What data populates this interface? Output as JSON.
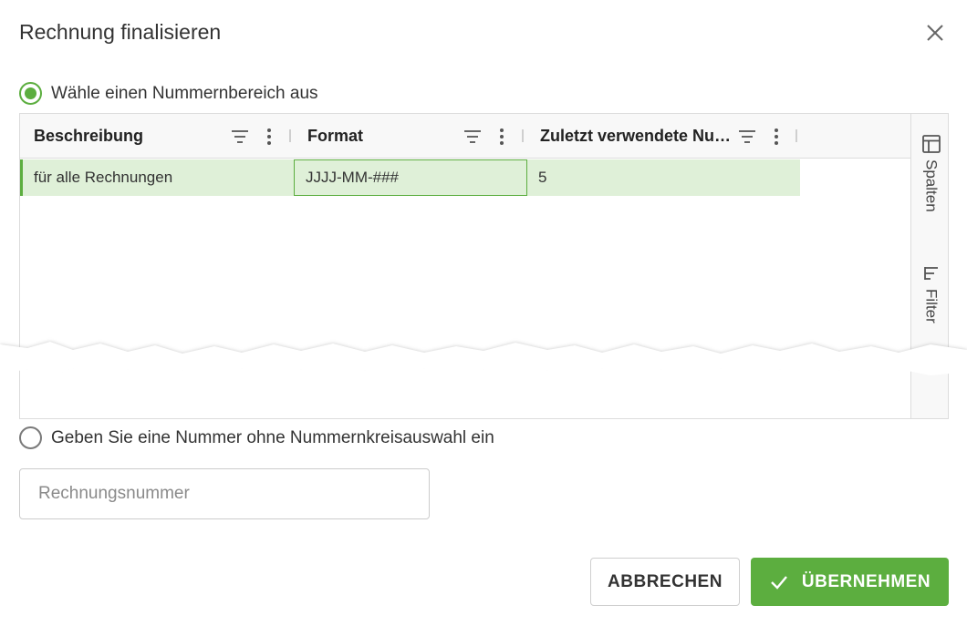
{
  "dialog": {
    "title": "Rechnung finalisieren"
  },
  "option_range": {
    "label": "Wähle einen Nummernbereich aus",
    "checked": true
  },
  "grid": {
    "columns": [
      {
        "label": "Beschreibung"
      },
      {
        "label": "Format"
      },
      {
        "label": "Zuletzt verwendete Nummer"
      }
    ],
    "rows": [
      {
        "beschreibung": "für alle Rechnungen",
        "format": "JJJJ-MM-###",
        "zuletzt": "5"
      }
    ],
    "side_panel": {
      "columns_label": "Spalten",
      "filter_label": "Filter"
    }
  },
  "option_manual": {
    "label": "Geben Sie eine Nummer ohne Nummernkreisauswahl ein",
    "checked": false
  },
  "invoice_input": {
    "placeholder": "Rechnungsnummer",
    "value": ""
  },
  "buttons": {
    "cancel_label": "ABBRECHEN",
    "apply_label": "ÜBERNEHMEN"
  },
  "colors": {
    "accent": "#5cae3f",
    "row_selected": "#dff0d8"
  }
}
